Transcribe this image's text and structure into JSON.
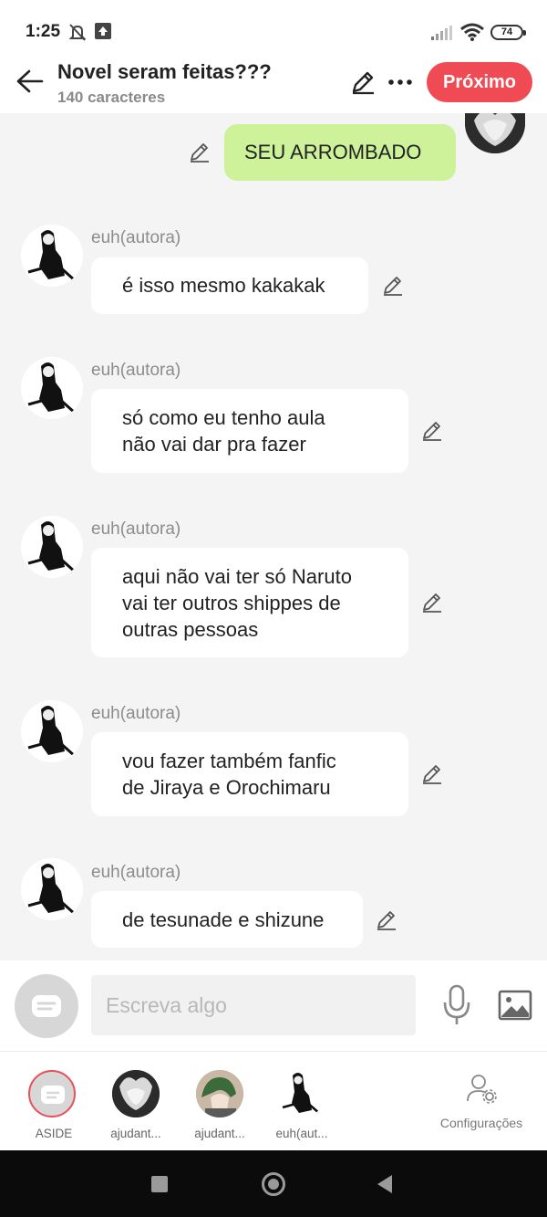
{
  "status_bar": {
    "time": "1:25",
    "battery": "74",
    "icons": [
      "bell-off-icon",
      "upload-icon",
      "signal-icon",
      "wifi-icon",
      "battery-icon"
    ]
  },
  "header": {
    "title": "Novel seram feitas???",
    "subtitle": "140 caracteres",
    "next_label": "Próximo",
    "accent_color": "#f04a54"
  },
  "own_message": {
    "text": "SEU ARROMBADO",
    "bubble_color": "#cdf29a"
  },
  "messages": [
    {
      "author": "euh(autora)",
      "lines": [
        "é isso mesmo kakakak"
      ]
    },
    {
      "author": "euh(autora)",
      "lines": [
        "só como eu  tenho aula",
        "não vai dar pra fazer"
      ]
    },
    {
      "author": "euh(autora)",
      "lines": [
        "aqui não vai ter só Naruto",
        "vai ter outros shippes de",
        "outras pessoas"
      ]
    },
    {
      "author": "euh(autora)",
      "lines": [
        "vou fazer também fanfic",
        "de Jiraya e Orochimaru"
      ]
    },
    {
      "author": "euh(autora)",
      "lines": [
        "de tesunade e shizune"
      ]
    }
  ],
  "composer": {
    "placeholder": "Escreva algo"
  },
  "tabs": [
    {
      "label": "ASIDE"
    },
    {
      "label": "ajudant..."
    },
    {
      "label": "ajudant..."
    },
    {
      "label": "euh(aut..."
    }
  ],
  "settings_label": "Configurações"
}
